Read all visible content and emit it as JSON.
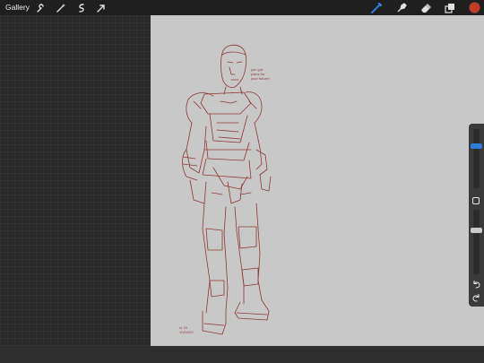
{
  "toolbar": {
    "gallery_label": "Gallery",
    "left_tools": [
      {
        "name": "wrench-icon"
      },
      {
        "name": "magic-wand-icon"
      },
      {
        "name": "selection-icon"
      },
      {
        "name": "transform-arrow-icon"
      }
    ],
    "right_tools": [
      {
        "name": "brush-icon",
        "active": true
      },
      {
        "name": "smudge-icon"
      },
      {
        "name": "eraser-icon"
      },
      {
        "name": "layers-icon"
      },
      {
        "name": "color-swatch"
      }
    ]
  },
  "colors": {
    "accent": "#2f7bdb",
    "current_color": "#c63a20",
    "sketch_line": "#8a3b34",
    "canvas_bg": "#c8c8c8"
  },
  "canvas": {
    "note_lines": [
      "you got",
      "plans for",
      "your future?"
    ],
    "signature_lines": [
      "m.19",
      "10/04/20"
    ]
  },
  "sidebar": {
    "brush_size": 0.27,
    "opacity": 0.31
  }
}
